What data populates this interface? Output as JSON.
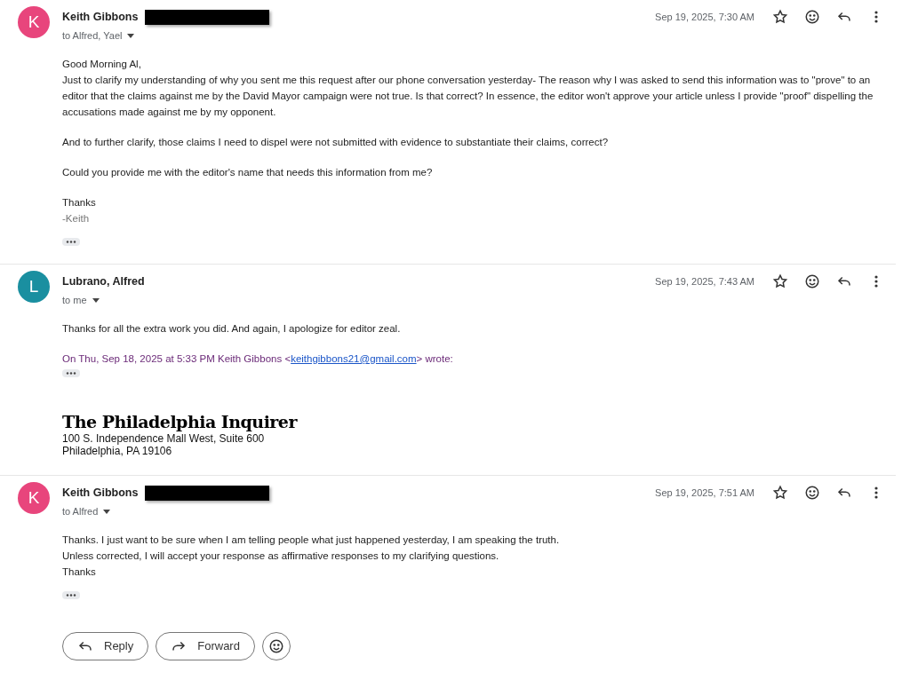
{
  "messages": [
    {
      "sender": "Keith Gibbons",
      "avatar": "K",
      "color": "#e8457c",
      "redacted": true,
      "recipients": "to Alfred, Yael",
      "date": "Sep 19, 2025, 7:30 AM",
      "paragraphs": [
        [
          "Good Morning Al,",
          "Just to clarify my understanding of why you sent me this request after our phone conversation yesterday- The reason why I was asked to send this information was to \"prove\" to an editor that the claims against me by the David Mayor campaign were not true. Is that correct? In essence, the editor won't approve your article unless I provide \"proof\" dispelling the accusations made against me by my opponent."
        ],
        [
          "And to further clarify, those claims I need to dispel were not submitted with evidence to substantiate their claims, correct?"
        ],
        [
          "Could you provide me with the editor's name that needs this information from me?"
        ],
        [
          "Thanks"
        ]
      ],
      "signature": "-Keith"
    },
    {
      "sender": "Lubrano, Alfred",
      "avatar": "L",
      "color": "#1a8fa0",
      "redacted": false,
      "recipients": "to me",
      "date": "Sep 19, 2025, 7:43 AM",
      "paragraphs": [
        [
          "Thanks for all the extra work you did. And again, I apologize for editor zeal."
        ]
      ],
      "quote": {
        "before": "On Thu, Sep 18, 2025 at 5:33 PM Keith Gibbons <",
        "link": "keithgibbons21@gmail.com",
        "after": "> wrote:"
      },
      "org": {
        "name": "The Philadelphia Inquirer",
        "address": [
          "100 S. Independence Mall West, Suite 600",
          "Philadelphia, PA 19106"
        ]
      }
    },
    {
      "sender": "Keith Gibbons",
      "avatar": "K",
      "color": "#e8457c",
      "redacted": true,
      "recipients": "to Alfred",
      "date": "Sep 19, 2025, 7:51 AM",
      "paragraphs": [
        [
          "Thanks. I just want to be sure when I am telling people what just happened yesterday, I am speaking the truth.",
          "Unless corrected, I will accept your response as affirmative responses to my clarifying questions.",
          "Thanks"
        ]
      ]
    }
  ],
  "actions": [
    {
      "kind": "reply",
      "label": "Reply"
    },
    {
      "kind": "forward",
      "label": "Forward"
    },
    {
      "kind": "react"
    }
  ]
}
